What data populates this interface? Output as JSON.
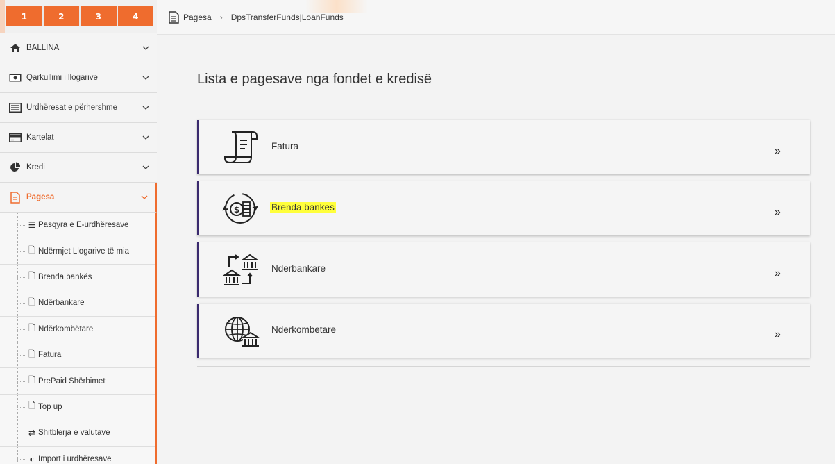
{
  "tabs": [
    "1",
    "2",
    "3",
    "4"
  ],
  "breadcrumb": {
    "section": "Pagesa",
    "page": "DpsTransferFunds|LoanFunds"
  },
  "sidebar": {
    "items": [
      {
        "label": "BALLINA",
        "icon": "home-icon"
      },
      {
        "label": "Qarkullimi i llogarive",
        "icon": "money-icon"
      },
      {
        "label": "Urdhëresat e përhershme",
        "icon": "list-icon"
      },
      {
        "label": "Kartelat",
        "icon": "card-icon"
      },
      {
        "label": "Kredi",
        "icon": "pie-icon"
      },
      {
        "label": "Pagesa",
        "icon": "document-icon",
        "active": true
      }
    ],
    "sub_items": [
      {
        "label": "Pasqyra e E-urdhëresave",
        "icon": "list-icon"
      },
      {
        "label": "Ndërmjet Llogarive të mia",
        "icon": "file-icon"
      },
      {
        "label": "Brenda bankës",
        "icon": "file-icon"
      },
      {
        "label": "Ndërbankare",
        "icon": "file-icon"
      },
      {
        "label": "Ndërkombëtare",
        "icon": "file-icon"
      },
      {
        "label": "Fatura",
        "icon": "file-icon"
      },
      {
        "label": "PrePaid Shërbimet",
        "icon": "file-icon"
      },
      {
        "label": "Top up",
        "icon": "file-icon"
      },
      {
        "label": "Shitblerja e valutave",
        "icon": "exchange-icon"
      },
      {
        "label": "Import i urdhëresave",
        "icon": "import-icon"
      }
    ]
  },
  "main": {
    "title": "Lista e pagesave nga fondet e kredisë",
    "cards": [
      {
        "label": "Fatura",
        "icon": "invoice-icon",
        "highlighted": false
      },
      {
        "label": "Brenda bankes",
        "icon": "money-exchange-icon",
        "highlighted": true
      },
      {
        "label": "Nderbankare",
        "icon": "bank-transfer-icon",
        "highlighted": false
      },
      {
        "label": "Nderkombetare",
        "icon": "globe-bank-icon",
        "highlighted": false
      }
    ],
    "card_arrow": "»"
  },
  "colors": {
    "accent": "#ef6c2e",
    "card_border": "#3a2a6e",
    "highlight": "#ffff3b"
  }
}
